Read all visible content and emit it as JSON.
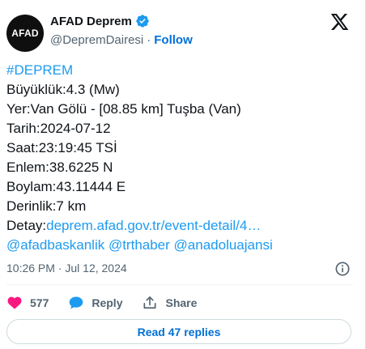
{
  "header": {
    "avatar_text": "AFAD",
    "display_name": "AFAD Deprem",
    "handle": "@DepremDairesi",
    "separator": "·",
    "follow_label": "Follow"
  },
  "tweet": {
    "hashtag": "#DEPREM",
    "lines": [
      "Büyüklük:4.3 (Mw)",
      "Yer:Van Gölü - [08.85 km] Tuşba (Van)",
      "Tarih:2024-07-12",
      "Saat:23:19:45 TSİ",
      "Enlem:38.6225 N",
      "Boylam:43.11444 E",
      "Derinlik:7 km"
    ],
    "detail_prefix": "Detay:",
    "detail_link": "deprem.afad.gov.tr/event-detail/4…",
    "mentions": [
      "@afadbaskanlik",
      "@trthaber",
      "@anadoluajansi"
    ]
  },
  "meta": {
    "timestamp": "10:26 PM · Jul 12, 2024"
  },
  "actions": {
    "like_count": "577",
    "reply_label": "Reply",
    "share_label": "Share"
  },
  "replies_button": "Read 47 replies",
  "colors": {
    "link": "#1d9bf0",
    "like": "#f91880",
    "reply_icon": "#1d9bf0",
    "verified": "#1d9bf0",
    "text_secondary": "#536471"
  },
  "icons": [
    "verified-badge-icon",
    "x-logo-icon",
    "info-icon",
    "heart-icon",
    "reply-bubble-icon",
    "share-icon"
  ]
}
